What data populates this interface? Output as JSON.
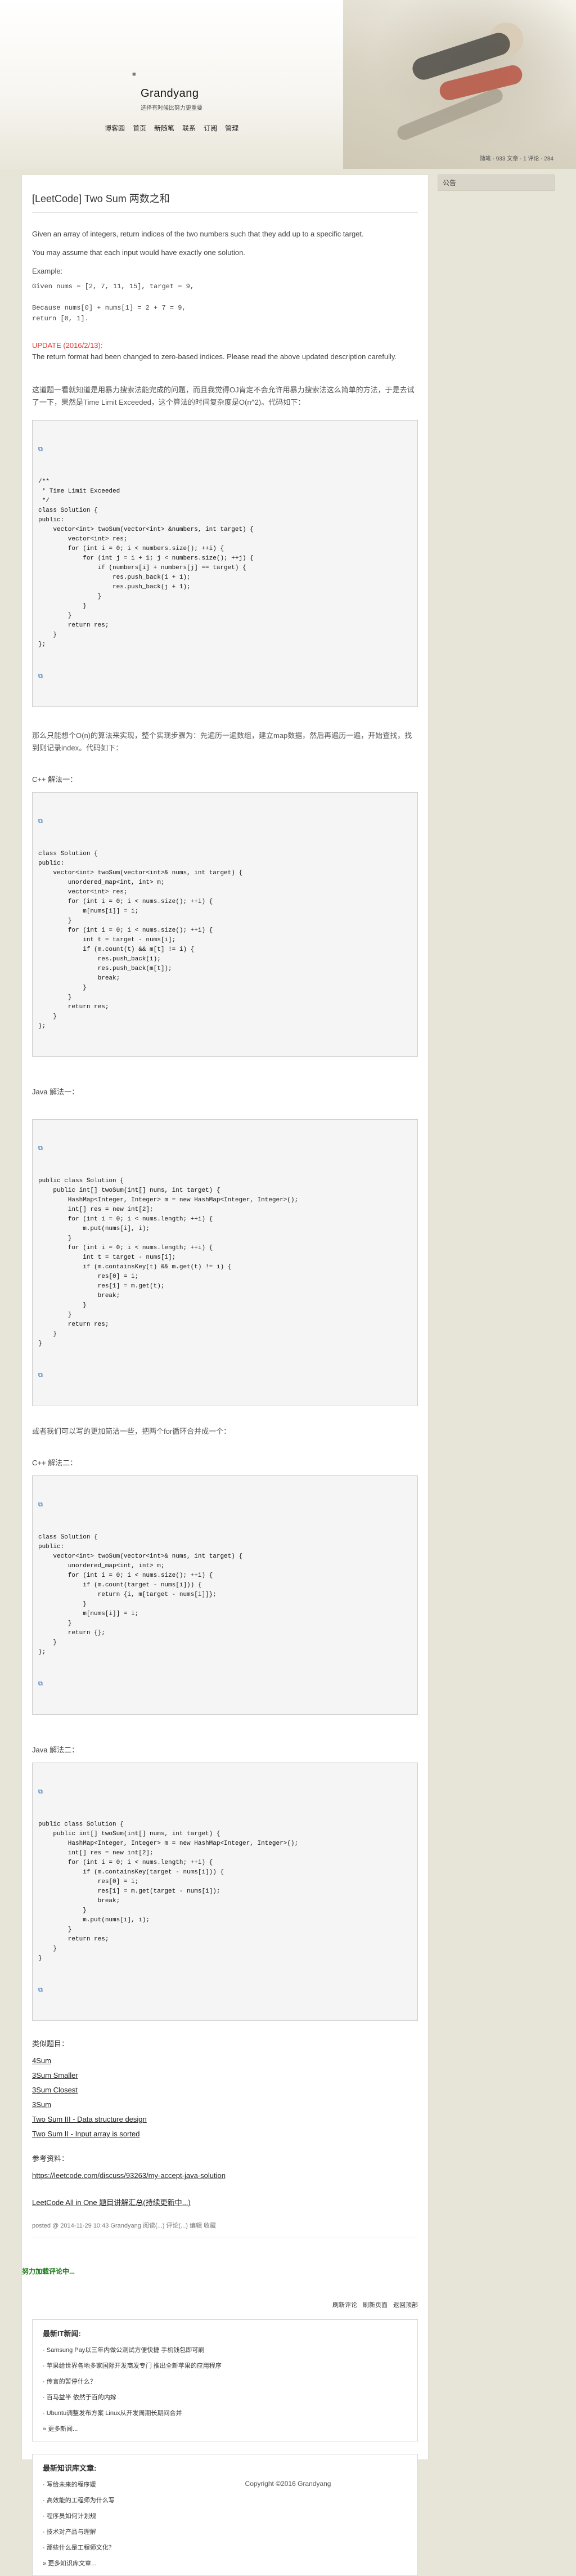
{
  "header": {
    "icon_text": "■",
    "blog_title": "Grandyang",
    "blog_subtitle": "选择有时候比努力更重要",
    "nav": [
      "博客园",
      "首页",
      "新随笔",
      "联系",
      "订阅",
      "管理"
    ],
    "stats": "随笔 - 933  文章 - 1  评论 - 284"
  },
  "sidebar": {
    "title": "公告"
  },
  "post": {
    "title": "[LeetCode] Two Sum 两数之和",
    "desc1": "Given an array of integers, return indices of the two numbers such that they add up to a specific target.",
    "desc2": "You may assume that each input would have exactly one solution.",
    "example_label": "Example:",
    "example_code": "Given nums = [2, 7, 11, 15], target = 9,\n\nBecause nums[0] + nums[1] = 2 + 7 = 9,\nreturn [0, 1].",
    "update_label": "UPDATE (2016/2/13):",
    "update_text": "The return format had been changed to zero-based indices. Please read the above updated description carefully.",
    "cn1": "这道题一看就知道是用暴力搜索法能完成的问题，而且我觉得OJ肯定不会允许用暴力搜索法这么简单的方法，于是去试了一下，果然是Time Limit Exceeded，这个算法的时间复杂度是O(n^2)。代码如下：",
    "code1": "/**\n * Time Limit Exceeded\n */\nclass Solution {\npublic:\n    vector<int> twoSum(vector<int> &numbers, int target) {\n        vector<int> res;\n        for (int i = 0; i < numbers.size(); ++i) {\n            for (int j = i + 1; j < numbers.size(); ++j) {\n                if (numbers[i] + numbers[j] == target) {\n                    res.push_back(i + 1);\n                    res.push_back(j + 1);\n                }\n            }\n        }\n        return res;\n    }\n};",
    "cn2": "那么只能想个O(n)的算法来实现，整个实现步骤为：先遍历一遍数组，建立map数据，然后再遍历一遍，开始查找，找到则记录index。代码如下：",
    "label_cpp1": "C++ 解法一：",
    "code2": "class Solution {\npublic:\n    vector<int> twoSum(vector<int>& nums, int target) {\n        unordered_map<int, int> m;\n        vector<int> res;\n        for (int i = 0; i < nums.size(); ++i) {\n            m[nums[i]] = i;\n        }\n        for (int i = 0; i < nums.size(); ++i) {\n            int t = target - nums[i];\n            if (m.count(t) && m[t] != i) {\n                res.push_back(i);\n                res.push_back(m[t]);\n                break;\n            }\n        }\n        return res;\n    }\n};",
    "label_java1": "Java 解法一：",
    "code3": "public class Solution {\n    public int[] twoSum(int[] nums, int target) {\n        HashMap<Integer, Integer> m = new HashMap<Integer, Integer>();\n        int[] res = new int[2];\n        for (int i = 0; i < nums.length; ++i) {\n            m.put(nums[i], i);\n        }\n        for (int i = 0; i < nums.length; ++i) {\n            int t = target - nums[i];\n            if (m.containsKey(t) && m.get(t) != i) {\n                res[0] = i;\n                res[1] = m.get(t);\n                break;\n            }\n        }\n        return res;\n    }\n}",
    "cn3": "或者我们可以写的更加简洁一些，把两个for循环合并成一个：",
    "label_cpp2": "C++ 解法二：",
    "code4": "class Solution {\npublic:\n    vector<int> twoSum(vector<int>& nums, int target) {\n        unordered_map<int, int> m;\n        for (int i = 0; i < nums.size(); ++i) {\n            if (m.count(target - nums[i])) {\n                return {i, m[target - nums[i]]};\n            }\n            m[nums[i]] = i;\n        }\n        return {};\n    }\n};",
    "label_java2": "Java 解法二：",
    "code5": "public class Solution {\n    public int[] twoSum(int[] nums, int target) {\n        HashMap<Integer, Integer> m = new HashMap<Integer, Integer>();\n        int[] res = new int[2];\n        for (int i = 0; i < nums.length; ++i) {\n            if (m.containsKey(target - nums[i])) {\n                res[0] = i;\n                res[1] = m.get(target - nums[i]);\n                break;\n            }\n            m.put(nums[i], i);\n        }\n        return res;\n    }\n}",
    "similar_title": "类似题目：",
    "similar": [
      "4Sum",
      "3Sum Smaller",
      "3Sum Closest",
      "3Sum",
      "Two Sum III - Data structure design",
      "Two Sum II - Input array is sorted"
    ],
    "ref_title": "参考资料：",
    "ref_link": "https://leetcode.com/discuss/93263/my-accept-java-solution",
    "all_in_one": "LeetCode All in One 题目讲解汇总(持续更新中...)",
    "footer": "posted @ 2014-11-29 10:43 Grandyang 阅读(...) 评论(...) 编辑 收藏"
  },
  "comments": {
    "loading": "努力加载评论中...",
    "links": [
      "刷新评论",
      "刷新页面",
      "返回顶部"
    ]
  },
  "news": {
    "title": "最新IT新闻:",
    "items": [
      "Samsung Pay以三年内做公测试方便快捷 手机钱包即可刷",
      "苹果给世界各地多家国际开发商发专门 推出全新苹果的应用程序",
      "传言的暂停什么？",
      "百马益半 依然于百的内嫁",
      "Ubuntu调整发布方案 Linux从开发周期长期间合并"
    ],
    "more": "» 更多新闻..."
  },
  "kb": {
    "title": "最新知识库文章:",
    "items": [
      "写给未来的程序媛",
      "高效能的工程师为什么写",
      "程序员如何计划规",
      "技术对产品与理解",
      "那些什么是工程师文化？"
    ],
    "more": "» 更多知识库文章..."
  },
  "footer": "Copyright ©2016 Grandyang"
}
